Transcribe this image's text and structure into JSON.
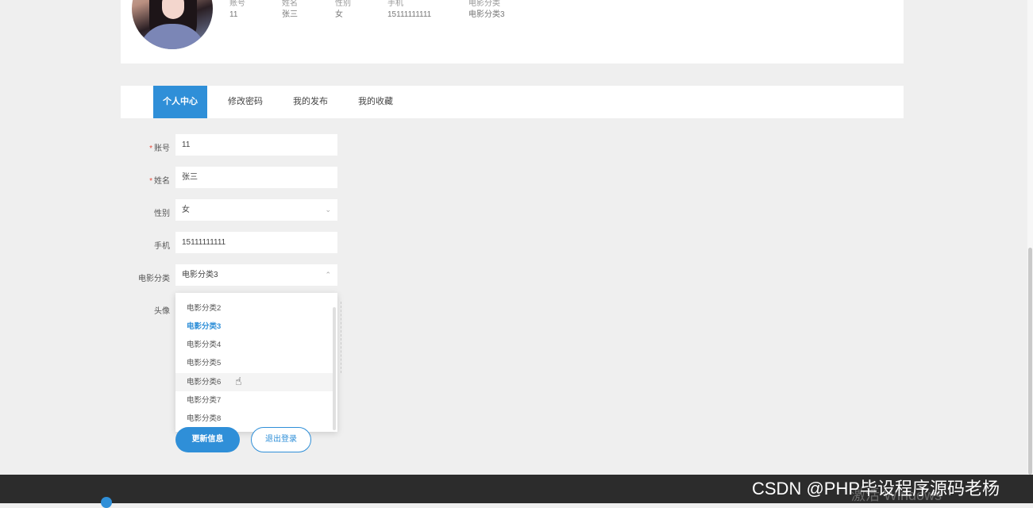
{
  "profile": {
    "fields": [
      {
        "key": "账号",
        "value": "11"
      },
      {
        "key": "姓名",
        "value": "张三"
      },
      {
        "key": "性别",
        "value": "女"
      },
      {
        "key": "手机",
        "value": "15111111111"
      },
      {
        "key": "电影分类",
        "value": "电影分类3"
      }
    ]
  },
  "tabs": [
    {
      "label": "个人中心"
    },
    {
      "label": "修改密码"
    },
    {
      "label": "我的发布"
    },
    {
      "label": "我的收藏"
    }
  ],
  "form": {
    "account_label": "账号",
    "account_value": "11",
    "name_label": "姓名",
    "name_value": "张三",
    "gender_label": "性别",
    "gender_value": "女",
    "phone_label": "手机",
    "phone_value": "15111111111",
    "category_label": "电影分类",
    "category_value": "电影分类3",
    "avatar_label": "头像",
    "required_mark": "*"
  },
  "dropdown": {
    "options": [
      "电影分类2",
      "电影分类3",
      "电影分类4",
      "电影分类5",
      "电影分类6",
      "电影分类7",
      "电影分类8"
    ],
    "selected": "电影分类3",
    "hovered": "电影分类6"
  },
  "buttons": {
    "update": "更新信息",
    "logout": "退出登录"
  },
  "watermarks": {
    "windows": "激活 Windows",
    "csdn": "CSDN @PHP毕设程序源码老杨"
  },
  "colors": {
    "accent": "#2f8fd8",
    "required": "#e74c3c"
  }
}
